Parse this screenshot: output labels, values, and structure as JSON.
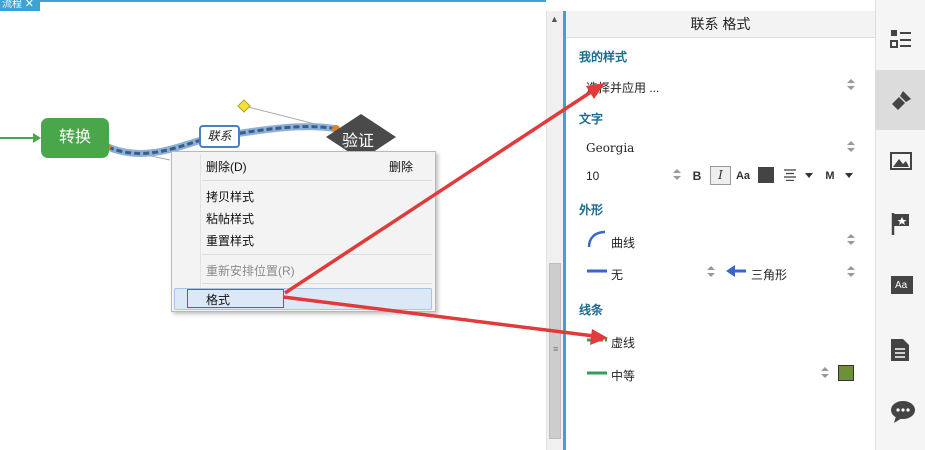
{
  "doc_tab": {
    "label": "流程",
    "close": "✕"
  },
  "canvas": {
    "node_transform": "转换",
    "node_verify": "验证",
    "relation_label": "联系"
  },
  "context_menu": {
    "items": [
      {
        "label": "删除(D)",
        "shortcut": "删除",
        "disabled": false
      },
      {
        "label": "拷贝样式",
        "shortcut": "",
        "disabled": false
      },
      {
        "label": "粘帖样式",
        "shortcut": "",
        "disabled": false
      },
      {
        "label": "重置样式",
        "shortcut": "",
        "disabled": false
      },
      {
        "label": "重新安排位置(R)",
        "shortcut": "",
        "disabled": true
      },
      {
        "label": "格式",
        "shortcut": "",
        "disabled": false
      }
    ]
  },
  "panel": {
    "title": "联系 格式",
    "my_style": {
      "heading": "我的样式",
      "select_value": "选择并应用 ..."
    },
    "text": {
      "heading": "文字",
      "font": "Georgia",
      "size": "10",
      "bold": "B",
      "italic": "I",
      "case": "Aa",
      "size_letter": "M"
    },
    "shape": {
      "heading": "外形",
      "line_shape": "曲线",
      "start_arrow": "无",
      "end_arrow": "三角形"
    },
    "line": {
      "heading": "线条",
      "pattern": "虚线",
      "width": "中等"
    }
  },
  "colors": {
    "accent": "#3ea2d2",
    "node_green": "#4aa64b",
    "node_dark": "#4a4a4a",
    "section_heading": "#1d6b8f",
    "annotation_red": "#e03a3a",
    "line_color_swatch": "#6e8f3a",
    "text_color_swatch": "#444444"
  },
  "sidebar_icons": [
    "outline-icon",
    "format-brush-icon",
    "image-icon",
    "marker-flag-icon",
    "text-label-icon",
    "notes-icon",
    "comments-icon"
  ]
}
